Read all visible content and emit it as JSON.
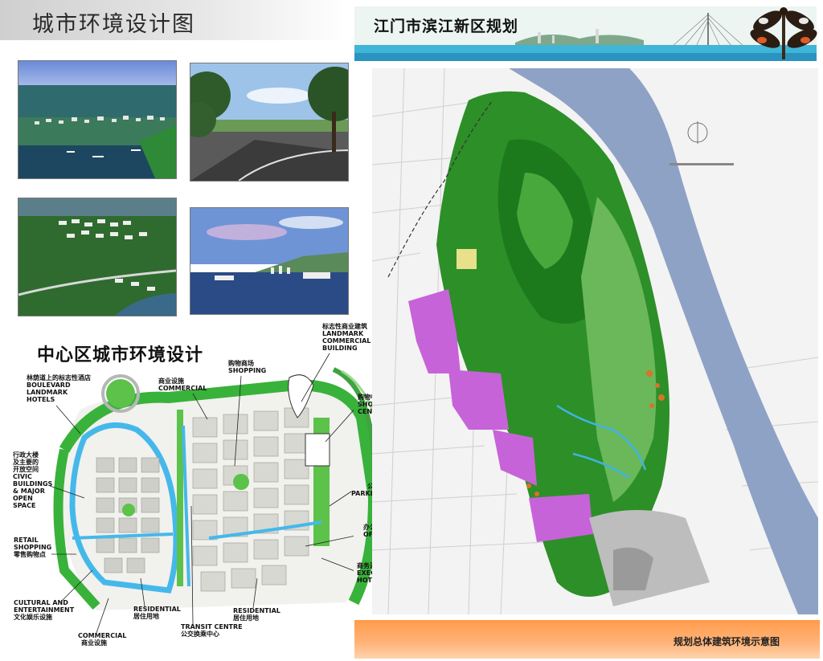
{
  "left_title": "城市环境设计图",
  "banner_title": "江门市滨江新区规划",
  "footer_caption": "规划总体建筑环境示意图",
  "center_title": "中心区城市环境设计",
  "labels": {
    "boulevard": {
      "cn": "林荫道上的标志性酒店",
      "en1": "BOULEVARD",
      "en2": "LANDMARK",
      "en3": "HOTELS"
    },
    "commercial_top": {
      "cn": "商业设施",
      "en1": "COMMERCIAL"
    },
    "shopping": {
      "cn": "购物商场",
      "en1": "SHOPPING"
    },
    "landmark": {
      "cn": "标志性商业建筑",
      "en1": "LANDMARK",
      "en2": "COMMERCIAL",
      "en3": "BUILDING"
    },
    "shopping_centre": {
      "cn": "购物中心",
      "en1": "SHOPPING",
      "en2": "CENTRE"
    },
    "civic": {
      "cn1": "行政大楼",
      "cn2": "及主要的",
      "cn3": "开放空间",
      "en1": "CIVIC",
      "en2": "BUILDINGS",
      "en3": "& MAJOR",
      "en4": "OPEN",
      "en5": "SPACE"
    },
    "parklands": {
      "cn": "公园",
      "en1": "PARKLANDS"
    },
    "offices": {
      "cn": "办公设施",
      "en1": "OFFICES"
    },
    "retail": {
      "en1": "RETAIL",
      "en2": "SHOPPING",
      "cn": "零售购物点"
    },
    "executive": {
      "cn": "商务酒店",
      "en1": "EXECUTIVE",
      "en2": "HOTEL"
    },
    "cultural": {
      "en1": "CULTURAL AND",
      "en2": "ENTERTAINMENT",
      "cn": "文化娱乐设施"
    },
    "residential_left": {
      "en1": "RESIDENTIAL",
      "cn": "居住用地"
    },
    "residential_right": {
      "en1": "RESIDENTIAL",
      "cn": "居住用地"
    },
    "transit": {
      "en1": "TRANSIT CENTRE",
      "cn": "公交换乘中心"
    },
    "commercial_bottom": {
      "en1": "COMMERCIAL",
      "cn": "商业设施"
    }
  },
  "colors": {
    "forest": "#1f8a1f",
    "forest_light": "#49b234",
    "river": "#8fa4c8",
    "commercial": "#c760d6",
    "footer": "#ff9b4a",
    "canal": "#43b7e8"
  }
}
